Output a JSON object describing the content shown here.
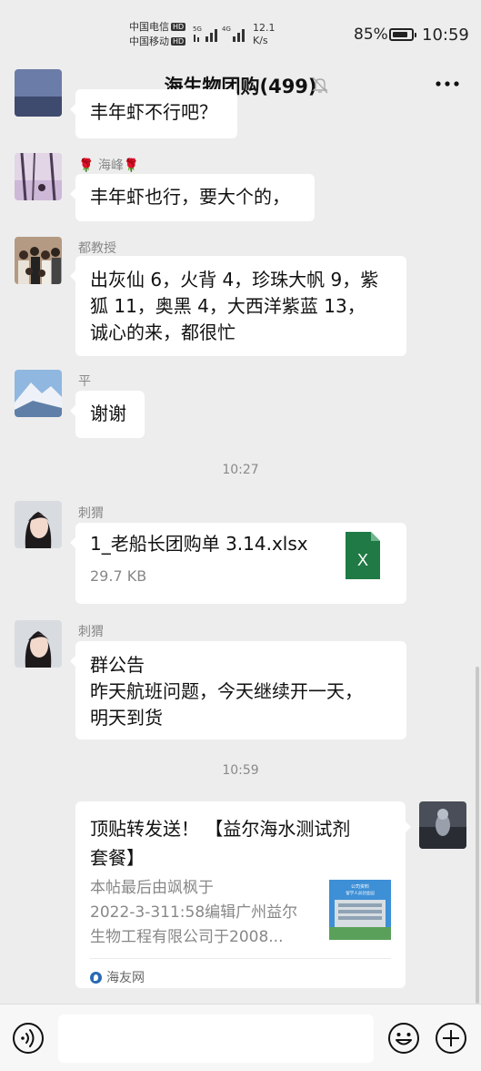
{
  "status_bar": {
    "carrier1": "中国电信",
    "carrier2": "中国移动",
    "hd": "HD",
    "net1": "5G",
    "net2": "4G",
    "speed_value": "12.1",
    "speed_unit": "K/s",
    "battery_pct": "85%",
    "battery_level": 0.85,
    "time": "10:59"
  },
  "header": {
    "title": "海生物团购(499)"
  },
  "messages": [
    {
      "type": "text",
      "text_lines": [
        "丰年虾不行吧？"
      ]
    },
    {
      "type": "text",
      "sender": "🌹 海峰🌹",
      "text_lines": [
        "丰年虾也行，要大个的，"
      ]
    },
    {
      "type": "text",
      "sender": "都教授",
      "text_lines": [
        "出灰仙 6，火背 4，珍珠大帆 9，紫",
        "狐 11，奥黑 4，大西洋紫蓝 13，",
        "诚心的来，都很忙"
      ]
    },
    {
      "type": "text",
      "sender": "平",
      "text_lines": [
        "谢谢"
      ]
    },
    {
      "type": "time",
      "time": "10:27"
    },
    {
      "type": "file",
      "sender": "刺猬",
      "file_name": "1_老船长团购单 3.14.xlsx",
      "file_size": "29.7 KB",
      "file_icon": "excel-icon",
      "file_icon_letter": "X"
    },
    {
      "type": "text",
      "sender": "刺猬",
      "text_lines": [
        "群公告",
        "昨天航班问题，今天继续开一天，",
        "明天到货"
      ]
    },
    {
      "type": "time",
      "time": "10:59"
    },
    {
      "type": "link",
      "title_lines": [
        "顶贴转发送！ 【益尔海水测试剂",
        "套餐】"
      ],
      "desc_lines": [
        "本帖最后由飒枫于",
        "2022-3-311:58编辑广州益尔",
        "生物工程有限公司于2008..."
      ],
      "thumb_text": [
        "公司资料",
        "留学人员创业园"
      ],
      "source": "海友网"
    }
  ],
  "input_bar": {
    "placeholder": ""
  },
  "colors": {
    "background": "#ededed",
    "bubble": "#ffffff",
    "excel_green": "#1f7a45",
    "secondary_text": "#888888"
  }
}
